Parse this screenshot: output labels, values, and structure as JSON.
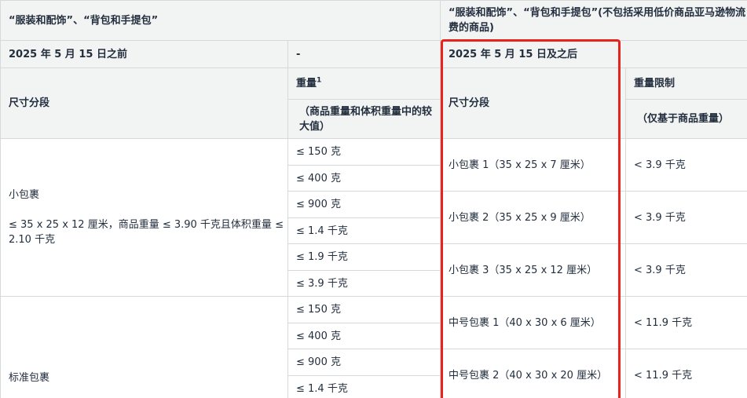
{
  "header": {
    "left_title": "“服装和配饰”、“背包和手提包”",
    "right_title": "“服装和配饰”、“背包和手提包”(不包括采用低价商品亚马逊物流费的商品)"
  },
  "period": {
    "before_label": "2025 年 5 月 15 日之前",
    "dash": "-",
    "after_label": "2025 年 5 月 15 日及之后"
  },
  "columns": {
    "size_tier": "尺寸分段",
    "weight": "重量",
    "weight_sup": "1",
    "weight_note": "（商品重量和体积重量中的较大值）",
    "size_tier_new": "尺寸分段",
    "weight_limit": "重量限制",
    "weight_limit_note": "（仅基于商品重量）"
  },
  "small": {
    "name": "小包裹",
    "rule": "≤ 35 x 25 x 12 厘米，商品重量 ≤ 3.90 千克且体积重量 ≤ 2.10 千克",
    "weights": [
      "≤ 150 克",
      "≤ 400 克",
      "≤ 900 克",
      "≤ 1.4 千克",
      "≤ 1.9 千克",
      "≤ 3.9 千克"
    ],
    "new_tiers": [
      {
        "name": "小包裹 1（35 x 25 x 7 厘米）",
        "limit": "< 3.9 千克"
      },
      {
        "name": "小包裹 2（35 x 25 x 9 厘米）",
        "limit": "< 3.9 千克"
      },
      {
        "name": "小包裹 3（35 x 25 x 12 厘米）",
        "limit": "< 3.9 千克"
      }
    ]
  },
  "standard": {
    "name": "标准包裹",
    "weights": [
      "≤ 150 克",
      "≤ 400 克",
      "≤ 900 克",
      "≤ 1.4 千克"
    ],
    "new_tiers": [
      {
        "name": "中号包裹 1（40 x 30 x 6 厘米）",
        "limit": "< 11.9 千克"
      },
      {
        "name": "中号包裹 2（40 x 30 x 20 厘米）",
        "limit": "< 11.9 千克"
      }
    ]
  },
  "colors": {
    "header_bg": "#f2f3f3",
    "border": "#d5d9d9",
    "highlight": "#e8231c",
    "text": "#232f3e"
  }
}
